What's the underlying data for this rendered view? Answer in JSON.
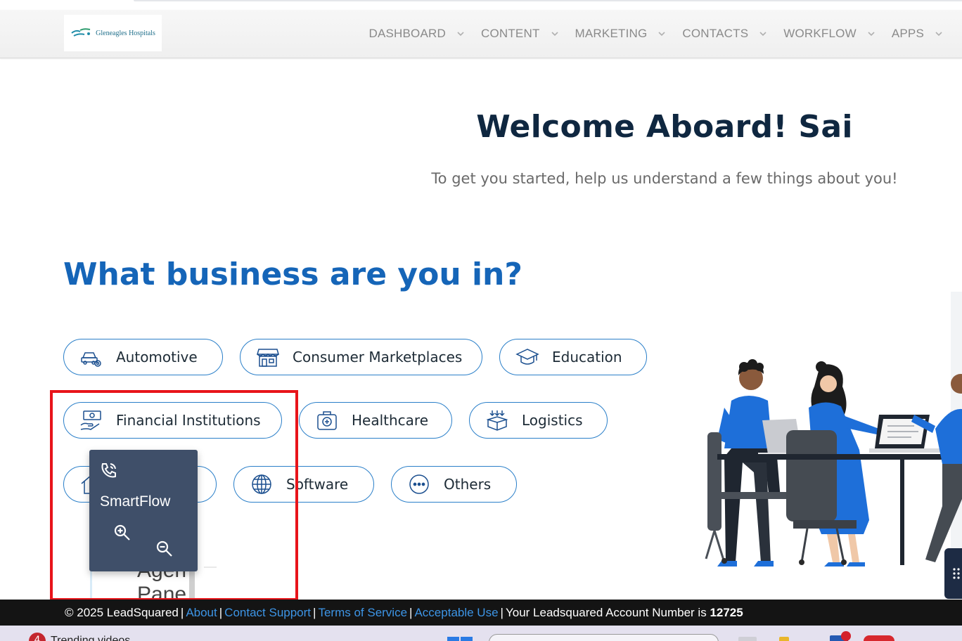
{
  "header": {
    "logo_text": "Gleneagles Hospitals",
    "nav": [
      {
        "label": "DASHBOARD",
        "has_caret": true
      },
      {
        "label": "CONTENT",
        "has_caret": true
      },
      {
        "label": "MARKETING",
        "has_caret": true
      },
      {
        "label": "CONTACTS",
        "has_caret": true
      },
      {
        "label": "WORKFLOW",
        "has_caret": true
      },
      {
        "label": "APPS",
        "has_caret": true
      }
    ]
  },
  "welcome": {
    "title": "Welcome Aboard! Sai",
    "subtitle": "To get you started, help us understand a few things about you!"
  },
  "business": {
    "question": "What business are you in?",
    "options": [
      {
        "label": "Automotive",
        "icon": "car-gear-icon"
      },
      {
        "label": "Consumer Marketplaces",
        "icon": "storefront-icon"
      },
      {
        "label": "Education",
        "icon": "graduation-cap-icon"
      },
      {
        "label": "Financial Institutions",
        "icon": "hand-money-icon"
      },
      {
        "label": "Healthcare",
        "icon": "medical-bag-icon"
      },
      {
        "label": "Logistics",
        "icon": "package-icon"
      },
      {
        "label": "",
        "icon": "house-icon"
      },
      {
        "label": "Software",
        "icon": "globe-icon"
      },
      {
        "label": "Others",
        "icon": "more-dots-icon"
      }
    ]
  },
  "smartflow": {
    "title": "SmartFlow",
    "underlay_text": "Agen Pane"
  },
  "footer": {
    "copyright": "© 2025 LeadSquared",
    "links": [
      "About",
      "Contact Support",
      "Terms of Service",
      "Acceptable Use"
    ],
    "account_prefix": "Your Leadsquared Account Number is",
    "account_number": "12725"
  },
  "taskbar": {
    "badge": "4",
    "text": "Trending videos"
  },
  "colors": {
    "primary_blue": "#1565b8",
    "dark_title": "#0f2740",
    "highlight_red": "#e8141a",
    "widget_bg": "#3f4f69",
    "footer_bg": "#141414",
    "link_blue": "#3d95e6"
  }
}
